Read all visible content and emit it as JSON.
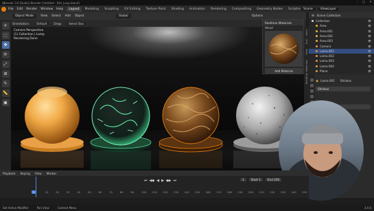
{
  "titlebar": {
    "title": "[Blender 3.0 Studio] Blender [Untitled - Dirt_Loop.blend]",
    "controls": [
      "–",
      "□",
      "✕"
    ]
  },
  "menubar": {
    "menus": [
      "File",
      "Edit",
      "Render",
      "Window",
      "Help"
    ],
    "workspaces": [
      "Layout",
      "Modeling",
      "Sculpting",
      "UV Editing",
      "Texture Paint",
      "Shading",
      "Animation",
      "Rendering",
      "Compositing",
      "Geometry Nodes",
      "Scripting"
    ],
    "active_workspace": "Layout",
    "scene_label": "Scene",
    "view_layer_label": "ViewLayer"
  },
  "viewport_header": {
    "mode": "Object Mode",
    "items": [
      "View",
      "Select",
      "Add",
      "Object"
    ],
    "orientation": "Global",
    "options_label": "Options"
  },
  "viewport_subheader": {
    "items": [
      "Orientation:",
      "Default",
      "Drag:",
      "Select Box"
    ]
  },
  "viewport": {
    "overlay_lines": [
      "Camera Perspective",
      "(1) Collection | Lamp",
      "Rendering Done"
    ]
  },
  "toolbar": {
    "tools": [
      "cursor",
      "select",
      "move",
      "rotate",
      "scale",
      "transform",
      "annotate",
      "measure",
      "add-cube"
    ]
  },
  "material_panel": {
    "title": "Realtime Materials",
    "subtitle": "Wood",
    "add_button": "Add Material"
  },
  "side_tabs": [
    "Item",
    "Tool",
    "View",
    "Realtime Materials"
  ],
  "outliner": {
    "header": "Scene Collection",
    "rows": [
      {
        "label": "Collection",
        "indent": 0,
        "selected": false,
        "color": "#c9c9c9"
      },
      {
        "label": "Area",
        "indent": 1,
        "selected": false,
        "color": "#e6a53b"
      },
      {
        "label": "Area.001",
        "indent": 1,
        "selected": false,
        "color": "#e6a53b"
      },
      {
        "label": "Area.002",
        "indent": 1,
        "selected": false,
        "color": "#e6a53b"
      },
      {
        "label": "Area.003",
        "indent": 1,
        "selected": false,
        "color": "#e6a53b"
      },
      {
        "label": "Camera",
        "indent": 1,
        "selected": false,
        "color": "#d98c4a"
      },
      {
        "label": "Lama.001",
        "indent": 1,
        "selected": true,
        "color": "#d98c4a"
      },
      {
        "label": "Lama.002",
        "indent": 1,
        "selected": false,
        "color": "#d98c4a"
      },
      {
        "label": "Lama.003",
        "indent": 1,
        "selected": false,
        "color": "#d98c4a"
      },
      {
        "label": "Lama.004",
        "indent": 1,
        "selected": false,
        "color": "#d98c4a"
      },
      {
        "label": "Plane",
        "indent": 1,
        "selected": false,
        "color": "#d98c4a"
      }
    ]
  },
  "properties": {
    "object_name": "Lama.001",
    "material_slot": "Shinkus",
    "material_name": "Shinkus"
  },
  "timeline": {
    "menus": [
      "Playback",
      "Keying",
      "View",
      "Marker"
    ],
    "current_frame": "1",
    "start": "Start 1",
    "end": "End 250",
    "ticks": [
      "0",
      "10",
      "20",
      "30",
      "40",
      "50",
      "60",
      "70",
      "80",
      "90",
      "100",
      "110",
      "120",
      "130",
      "140",
      "150",
      "160",
      "170",
      "180",
      "190",
      "200",
      "210",
      "220",
      "230",
      "240",
      "250"
    ]
  },
  "statusbar": {
    "items": [
      "Set Active Modifier",
      "Pan View",
      "Context Menu"
    ],
    "version": "3.0.0"
  },
  "colors": {
    "accent": "#4f86e0",
    "orange": "#e87d0d",
    "selection": "#334d80"
  }
}
